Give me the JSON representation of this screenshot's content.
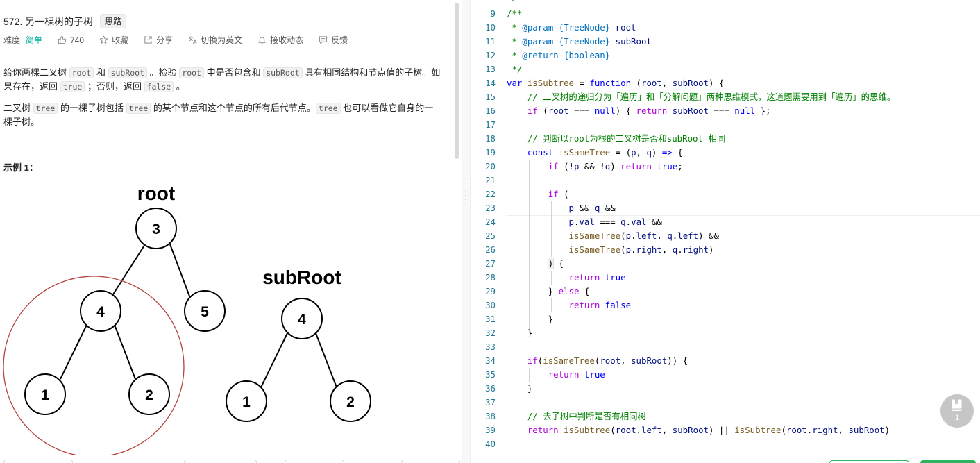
{
  "problem": {
    "title": "572. 另一棵树的子树",
    "tag": "思路",
    "meta": {
      "difficulty_label": "难度",
      "difficulty_value": "简单",
      "likes": "740",
      "favorite": "收藏",
      "share": "分享",
      "switch_lang": "切换为英文",
      "notifications": "接收动态",
      "feedback": "反馈"
    },
    "description": {
      "p1": {
        "t1": "给你两棵二叉树 ",
        "c1": "root",
        "t2": " 和 ",
        "c2": "subRoot",
        "t3": " 。检验 ",
        "c3": "root",
        "t4": " 中是否包含和 ",
        "c4": "subRoot",
        "t5": " 具有相同结构和节点值的子树。如果存在，返回 ",
        "c5": "true",
        "t6": " ；否则，返回 ",
        "c6": "false",
        "t7": " 。"
      },
      "p2": {
        "t1": "二叉树 ",
        "c1": "tree",
        "t2": " 的一棵子树包括 ",
        "c2": "tree",
        "t3": " 的某个节点和这个节点的所有后代节点。",
        "c3": "tree",
        "t4": " 也可以看做它自身的一棵子树。"
      }
    },
    "example_title": "示例 1：",
    "figure": {
      "root_label": "root",
      "subroot_label": "subRoot",
      "root_tree": [
        "3",
        "4",
        "5",
        "1",
        "2"
      ],
      "sub_tree": [
        "4",
        "1",
        "2"
      ]
    }
  },
  "editor": {
    "line_numbers": [
      "9",
      "10",
      "11",
      "12",
      "13",
      "14",
      "15",
      "16",
      "17",
      "18",
      "19",
      "20",
      "21",
      "22",
      "23",
      "24",
      "25",
      "26",
      "27",
      "28",
      "29",
      "30",
      "31",
      "32",
      "33",
      "34",
      "35",
      "36",
      "37",
      "38",
      "39",
      "40"
    ],
    "tokens": {
      "l9": "/**",
      "l10a": " * ",
      "l10b": "@param",
      "l10c": " {TreeNode}",
      "l10d": " root",
      "l11a": " * ",
      "l11b": "@param",
      "l11c": " {TreeNode}",
      "l11d": " subRoot",
      "l12a": " * ",
      "l12b": "@return",
      "l12c": " {boolean}",
      "l13": " */",
      "l14a": "var",
      "l14b": " isSubtree",
      "l14c": " = ",
      "l14d": "function",
      "l14e": " (",
      "l14f": "root",
      "l14g": ", ",
      "l14h": "subRoot",
      "l14i": ") {",
      "l15": "    // 二叉树的递归分为「遍历」和「分解问题」两种思维模式，这道题需要用到「遍历」的思维。",
      "l16a": "    ",
      "l16b": "if",
      "l16c": " (",
      "l16d": "root",
      "l16e": " === ",
      "l16f": "null",
      "l16g": ") { ",
      "l16h": "return",
      "l16i": " subRoot",
      "l16j": " === ",
      "l16k": "null",
      "l16l": " };",
      "l18": "    // 判断以root为根的二叉树是否和subRoot 相同",
      "l19a": "    ",
      "l19b": "const",
      "l19c": " isSameTree",
      "l19d": " = (",
      "l19e": "p",
      "l19f": ", ",
      "l19g": "q",
      "l19h": ") ",
      "l19i": "=>",
      "l19j": " {",
      "l20a": "        ",
      "l20b": "if",
      "l20c": " (!",
      "l20d": "p",
      "l20e": " && !",
      "l20f": "q",
      "l20g": ") ",
      "l20h": "return",
      "l20i": " true",
      "l20j": ";",
      "l22a": "        ",
      "l22b": "if",
      "l22c": " (",
      "l23a": "            ",
      "l23b": "p",
      "l23c": " && ",
      "l23d": "q",
      "l23e": " &&",
      "l24a": "            ",
      "l24b": "p",
      "l24c": ".",
      "l24d": "val",
      "l24e": " === ",
      "l24f": "q",
      "l24g": ".",
      "l24h": "val",
      "l24i": " &&",
      "l25a": "            ",
      "l25b": "isSameTree",
      "l25c": "(",
      "l25d": "p",
      "l25e": ".",
      "l25f": "left",
      "l25g": ", ",
      "l25h": "q",
      "l25i": ".",
      "l25j": "left",
      "l25k": ") &&",
      "l26a": "            ",
      "l26b": "isSameTree",
      "l26c": "(",
      "l26d": "p",
      "l26e": ".",
      "l26f": "right",
      "l26g": ", ",
      "l26h": "q",
      "l26i": ".",
      "l26j": "right",
      "l26k": ")",
      "l27a": "        ",
      "l27b": ")",
      "l27c": " {",
      "l28a": "            ",
      "l28b": "return",
      "l28c": " true",
      "l29a": "        ",
      "l29b": "}",
      "l29c": " else",
      "l29d": " {",
      "l30a": "            ",
      "l30b": "return",
      "l30c": " false",
      "l31": "        }",
      "l32": "    }",
      "l34a": "    ",
      "l34b": "if",
      "l34c": "(",
      "l34d": "isSameTree",
      "l34e": "(",
      "l34f": "root",
      "l34g": ", ",
      "l34h": "subRoot",
      "l34i": ")) {",
      "l35a": "        ",
      "l35b": "return",
      "l35c": " true",
      "l36": "    }",
      "l38": "    // 去子树中判断是否有相同树",
      "l39a": "    ",
      "l39b": "return",
      "l39c": " isSubtree",
      "l39d": "(",
      "l39e": "root",
      "l39f": ".",
      "l39g": "left",
      "l39h": ", ",
      "l39i": "subRoot",
      "l39j": ") || ",
      "l39k": "isSubtree",
      "l39l": "(",
      "l39m": "root",
      "l39n": ".",
      "l39o": "right",
      "l39p": ", ",
      "l39q": "subRoot",
      "l39r": ")"
    }
  },
  "notes_fab": {
    "count": "1"
  }
}
